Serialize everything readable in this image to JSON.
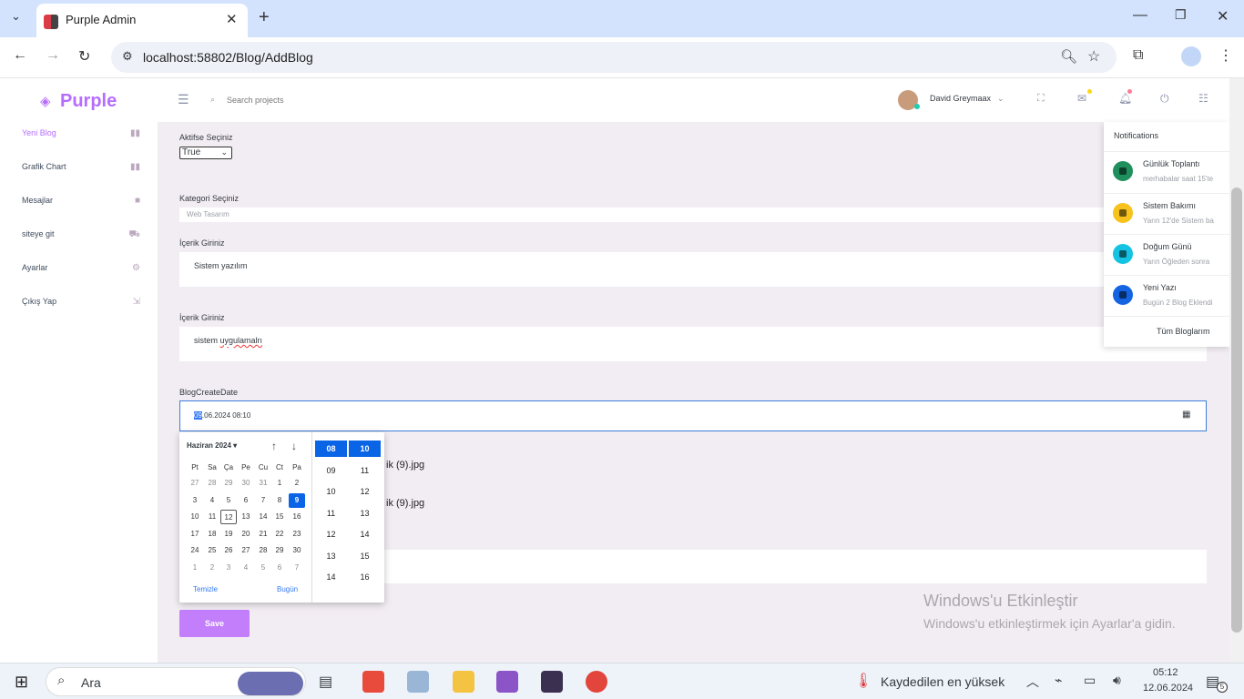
{
  "browser": {
    "tab_title": "Purple Admin",
    "url": "localhost:58802/Blog/AddBlog"
  },
  "sidebar": {
    "brand": "Purple",
    "items": [
      {
        "label": "Yeni Blog",
        "icon": "chart-bar-icon",
        "active": true
      },
      {
        "label": "Grafik Chart",
        "icon": "chart-bar-icon"
      },
      {
        "label": "Mesajlar",
        "icon": "message-icon"
      },
      {
        "label": "siteye git",
        "icon": "car-icon"
      },
      {
        "label": "Ayarlar",
        "icon": "gear-icon"
      },
      {
        "label": "Çıkış Yap",
        "icon": "logout-icon"
      }
    ]
  },
  "navbar": {
    "search_placeholder": "Search projects",
    "user_name": "David Greymaax"
  },
  "form": {
    "active_label": "Aktifse Seçiniz",
    "active_value": "True",
    "category_label": "Kategori Seçiniz",
    "category_value": "Web Tasarım",
    "content1_label": "İçerik Giriniz",
    "content1_value": "Sistem yazılım",
    "content2_label": "İçerik Giriniz",
    "content2_value_a": "sistem",
    "content2_value_b": "uygulamalrı",
    "date_label": "BlogCreateDate",
    "date_value_sel": "09",
    "date_value_rest": ".06.2024 08:10",
    "file1": "ik (9).jpg",
    "file2": "ik (9).jpg",
    "save_label": "Save"
  },
  "datepicker": {
    "month": "Haziran 2024 ▾",
    "weekdays": [
      "Pt",
      "Sa",
      "Ça",
      "Pe",
      "Cu",
      "Ct",
      "Pa"
    ],
    "weeks": [
      [
        "27",
        "28",
        "29",
        "30",
        "31",
        "1",
        "2"
      ],
      [
        "3",
        "4",
        "5",
        "6",
        "7",
        "8",
        "9"
      ],
      [
        "10",
        "11",
        "12",
        "13",
        "14",
        "15",
        "16"
      ],
      [
        "17",
        "18",
        "19",
        "20",
        "21",
        "22",
        "23"
      ],
      [
        "24",
        "25",
        "26",
        "27",
        "28",
        "29",
        "30"
      ],
      [
        "1",
        "2",
        "3",
        "4",
        "5",
        "6",
        "7"
      ]
    ],
    "selected_day": "9",
    "today_day": "12",
    "clear_label": "Temizle",
    "today_label": "Bugün",
    "hours": [
      "08",
      "09",
      "10",
      "11",
      "12",
      "13",
      "14"
    ],
    "minutes": [
      "10",
      "11",
      "12",
      "13",
      "14",
      "15",
      "16"
    ]
  },
  "notifications": {
    "title": "Notifications",
    "items": [
      {
        "title": "Günlük Toplantı",
        "text": "merhabalar saat 15'te",
        "color": "#1bcf8a"
      },
      {
        "title": "Sistem Bakımı",
        "text": "Yarın 12'de Sistem ba",
        "color": "#fed713"
      },
      {
        "title": "Doğum Günü",
        "text": "Yarın Öğleden sonra",
        "color": "#19d895"
      },
      {
        "title": "Yeni Yazı",
        "text": "Bugün 2 Blog Eklendi",
        "color": "#198ae3"
      }
    ],
    "footer": "Tüm Bloglarım"
  },
  "watermark": {
    "title": "Windows'u Etkinleştir",
    "text": "Windows'u etkinleştirmek için Ayarlar'a gidin."
  },
  "taskbar": {
    "search_label": "Ara",
    "weather": "Kaydedilen en yüksek",
    "time": "05:12",
    "date": "12.06.2024",
    "badge": "5"
  }
}
